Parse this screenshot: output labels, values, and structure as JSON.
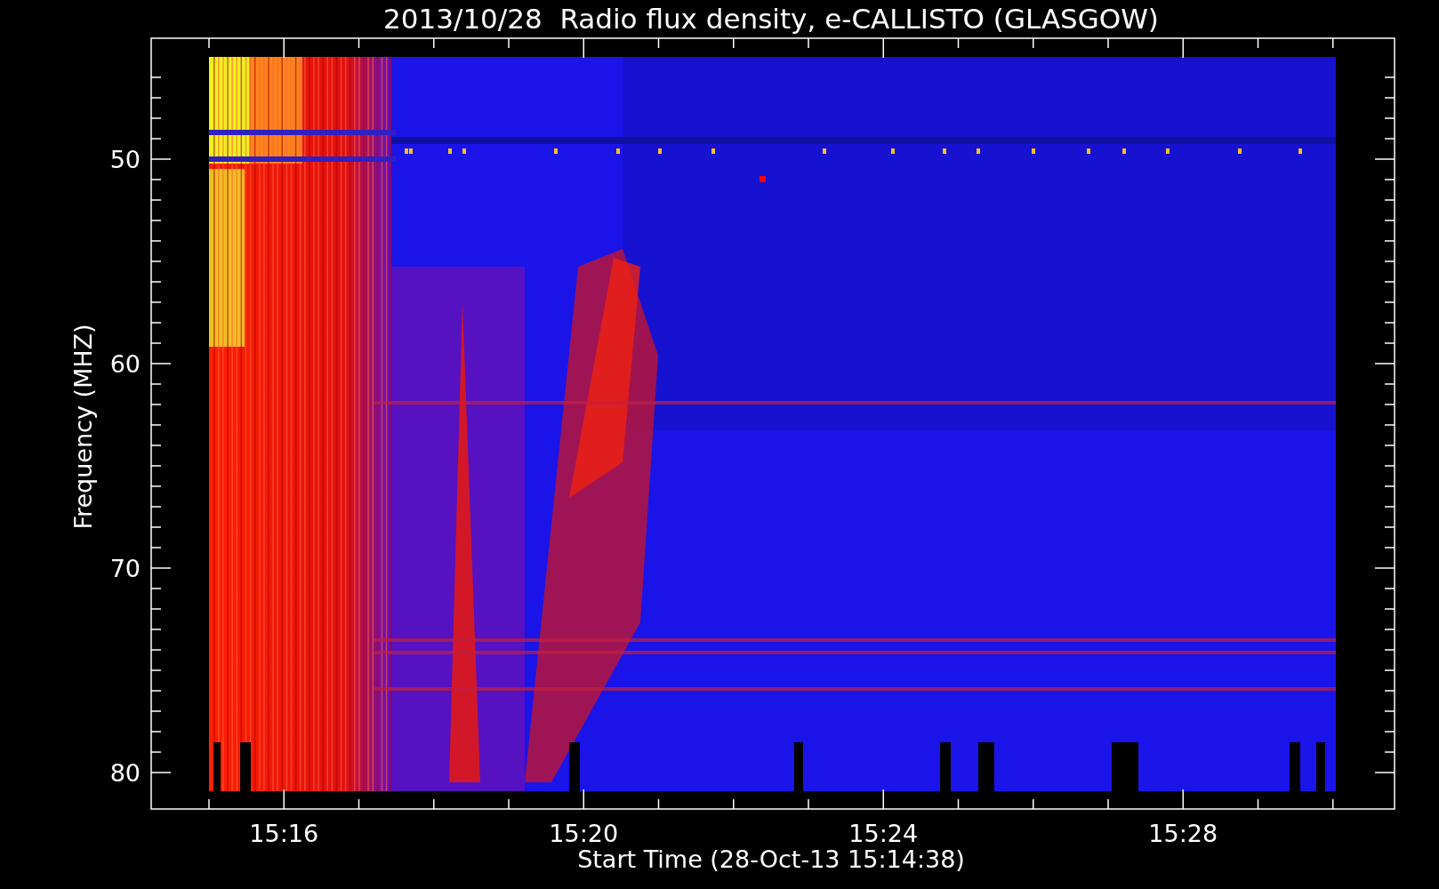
{
  "title": "2013/10/28  Radio flux density, e-CALLISTO (GLASGOW)",
  "y_axis": {
    "label": "Frequency (MHZ)",
    "ticks": [
      "50",
      "60",
      "70",
      "80"
    ]
  },
  "x_axis": {
    "label": "Start Time (28-Oct-13 15:14:38)",
    "ticks": [
      "15:16",
      "15:20",
      "15:24",
      "15:28"
    ]
  }
}
